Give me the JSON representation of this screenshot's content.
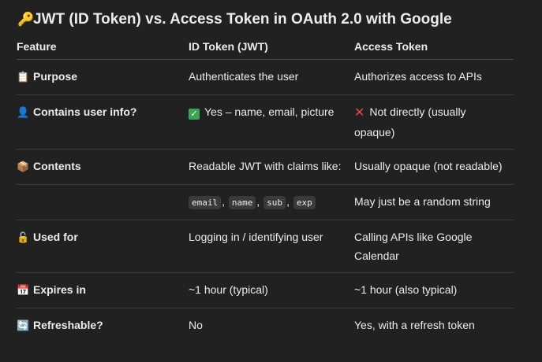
{
  "title": {
    "icon": "key-icon",
    "text": "JWT (ID Token) vs. Access Token in OAuth 2.0 with Google"
  },
  "table": {
    "headers": [
      "Feature",
      "ID Token (JWT)",
      "Access Token"
    ],
    "rows": [
      {
        "icon": "clipboard-icon",
        "feature": "Purpose",
        "id_token": "Authenticates the user",
        "access_token": "Authorizes access to APIs"
      },
      {
        "icon": "person-icon",
        "feature": "Contains user info?",
        "id_token": "Yes – name, email, picture",
        "id_mark": "check-mark-icon",
        "access_token": "Not directly (usually opaque)",
        "access_mark": "cross-mark-icon"
      },
      {
        "icon": "package-icon",
        "feature": "Contents",
        "id_token": "Readable JWT with claims like:",
        "access_token": "Usually opaque (not readable)"
      },
      {
        "feature": "",
        "claims": [
          "email",
          "name",
          "sub",
          "exp"
        ],
        "access_token": "May just be a random string"
      },
      {
        "icon": "unlock-icon",
        "feature": "Used for",
        "id_token": "Logging in / identifying user",
        "access_token": "Calling APIs like Google Calendar"
      },
      {
        "icon": "calendar-icon",
        "feature": "Expires in",
        "id_token": "~1 hour (typical)",
        "access_token": "~1 hour (also typical)"
      },
      {
        "icon": "refresh-icon",
        "feature": "Refreshable?",
        "id_token": "No",
        "access_token": "Yes, with a refresh token"
      }
    ]
  }
}
